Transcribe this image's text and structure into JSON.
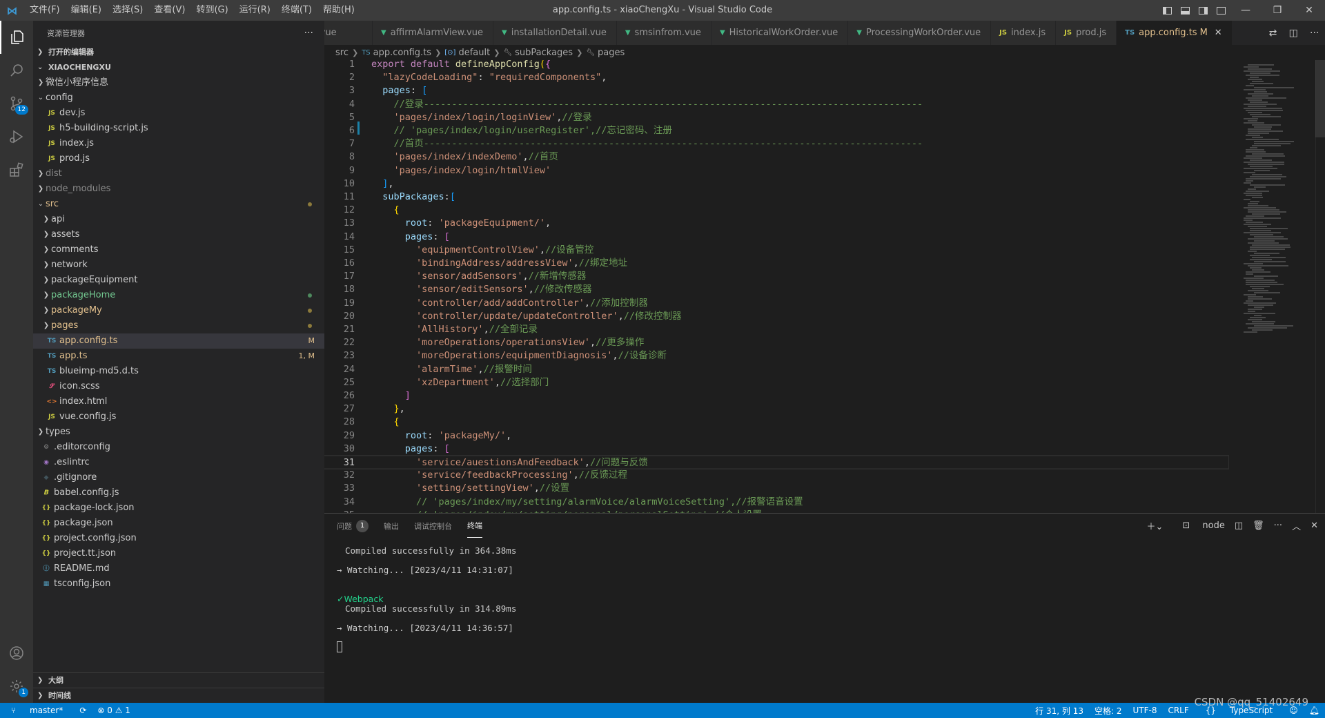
{
  "titlebar": {
    "title": "app.config.ts - xiaoChengXu - Visual Studio Code",
    "menu": [
      "文件(F)",
      "编辑(E)",
      "选择(S)",
      "查看(V)",
      "转到(G)",
      "运行(R)",
      "终端(T)",
      "帮助(H)"
    ],
    "window_controls": [
      "—",
      "❐",
      "✕"
    ]
  },
  "activitybar": {
    "scm_badge": "12",
    "settings_badge": "1"
  },
  "sidebar": {
    "header": "资源管理器",
    "more": "···",
    "open_editors": "打开的编辑器",
    "project": "XIAOCHENGXU",
    "outline": "大纲",
    "timeline": "时间线",
    "tree": [
      {
        "name": "微信小程序信息",
        "indent": 1,
        "type": "folder",
        "open": false
      },
      {
        "name": "config",
        "indent": 1,
        "type": "folder",
        "open": true
      },
      {
        "name": "dev.js",
        "indent": 2,
        "type": "js"
      },
      {
        "name": "h5-building-script.js",
        "indent": 2,
        "type": "js"
      },
      {
        "name": "index.js",
        "indent": 2,
        "type": "js"
      },
      {
        "name": "prod.js",
        "indent": 2,
        "type": "js"
      },
      {
        "name": "dist",
        "indent": 1,
        "type": "folder",
        "open": false,
        "dim": true
      },
      {
        "name": "node_modules",
        "indent": 1,
        "type": "folder",
        "open": false,
        "dim": true
      },
      {
        "name": "src",
        "indent": 1,
        "type": "folder",
        "open": true,
        "color": "yellow",
        "dot": true
      },
      {
        "name": "api",
        "indent": 2,
        "type": "folder",
        "open": false
      },
      {
        "name": "assets",
        "indent": 2,
        "type": "folder",
        "open": false
      },
      {
        "name": "comments",
        "indent": 2,
        "type": "folder",
        "open": false
      },
      {
        "name": "network",
        "indent": 2,
        "type": "folder",
        "open": false
      },
      {
        "name": "packageEquipment",
        "indent": 2,
        "type": "folder",
        "open": false
      },
      {
        "name": "packageHome",
        "indent": 2,
        "type": "folder",
        "open": false,
        "color": "green",
        "dot": true
      },
      {
        "name": "packageMy",
        "indent": 2,
        "type": "folder",
        "open": false,
        "color": "yellow",
        "dot": true
      },
      {
        "name": "pages",
        "indent": 2,
        "type": "folder",
        "open": false,
        "color": "yellow",
        "dot": true
      },
      {
        "name": "app.config.ts",
        "indent": 2,
        "type": "ts",
        "color": "yellow",
        "deco": "M",
        "selected": true
      },
      {
        "name": "app.ts",
        "indent": 2,
        "type": "ts",
        "color": "yellow",
        "deco": "1, M"
      },
      {
        "name": "blueimp-md5.d.ts",
        "indent": 2,
        "type": "ts"
      },
      {
        "name": "icon.scss",
        "indent": 2,
        "type": "scss"
      },
      {
        "name": "index.html",
        "indent": 2,
        "type": "html"
      },
      {
        "name": "vue.config.js",
        "indent": 2,
        "type": "js"
      },
      {
        "name": "types",
        "indent": 1,
        "type": "folder",
        "open": false
      },
      {
        "name": ".editorconfig",
        "indent": 1,
        "type": "gear"
      },
      {
        "name": ".eslintrc",
        "indent": 1,
        "type": "eslint"
      },
      {
        "name": ".gitignore",
        "indent": 1,
        "type": "git"
      },
      {
        "name": "babel.config.js",
        "indent": 1,
        "type": "babel"
      },
      {
        "name": "package-lock.json",
        "indent": 1,
        "type": "json"
      },
      {
        "name": "package.json",
        "indent": 1,
        "type": "json"
      },
      {
        "name": "project.config.json",
        "indent": 1,
        "type": "json"
      },
      {
        "name": "project.tt.json",
        "indent": 1,
        "type": "json"
      },
      {
        "name": "README.md",
        "indent": 1,
        "type": "info"
      },
      {
        "name": "tsconfig.json",
        "indent": 1,
        "type": "tsjson"
      }
    ]
  },
  "tabs": [
    {
      "label": "i.vue",
      "icon": "",
      "type": "vue"
    },
    {
      "label": "affirmAlarmView.vue",
      "icon": "▼",
      "type": "vue"
    },
    {
      "label": "installationDetail.vue",
      "icon": "▼",
      "type": "vue"
    },
    {
      "label": "smsinfrom.vue",
      "icon": "▼",
      "type": "vue"
    },
    {
      "label": "HistoricalWorkOrder.vue",
      "icon": "▼",
      "type": "vue"
    },
    {
      "label": "ProcessingWorkOrder.vue",
      "icon": "▼",
      "type": "vue"
    },
    {
      "label": "index.js",
      "icon": "JS",
      "type": "js"
    },
    {
      "label": "prod.js",
      "icon": "JS",
      "type": "js"
    },
    {
      "label": "app.config.ts",
      "icon": "TS",
      "type": "ts",
      "active": true,
      "modified": "M",
      "close": "✕"
    }
  ],
  "breadcrumb": [
    "src",
    "app.config.ts",
    "default",
    "subPackages",
    "pages"
  ],
  "editor": {
    "current_line": 31,
    "lines": [
      [
        [
          "kw",
          "export default "
        ],
        [
          "fn",
          "defineAppConfig"
        ],
        [
          "b1",
          "("
        ],
        [
          "b2",
          "{"
        ]
      ],
      [
        [
          "p",
          "  "
        ],
        [
          "str",
          "\"lazyCodeLoading\""
        ],
        [
          "p",
          ": "
        ],
        [
          "str",
          "\"requiredComponents\""
        ],
        [
          "p",
          ","
        ]
      ],
      [
        [
          "p",
          "  "
        ],
        [
          "prop",
          "pages"
        ],
        [
          "p",
          ": "
        ],
        [
          "b3",
          "["
        ]
      ],
      [
        [
          "p",
          "    "
        ],
        [
          "cm",
          "//登录-----------------------------------------------------------------------------------------"
        ]
      ],
      [
        [
          "p",
          "    "
        ],
        [
          "str",
          "'pages/index/login/loginView'"
        ],
        [
          "p",
          ","
        ],
        [
          "cm",
          "//登录"
        ]
      ],
      [
        [
          "p",
          "    "
        ],
        [
          "cm",
          "// 'pages/index/login/userRegister',//忘记密码、注册"
        ]
      ],
      [
        [
          "p",
          "    "
        ],
        [
          "cm",
          "//首页-----------------------------------------------------------------------------------------"
        ]
      ],
      [
        [
          "p",
          "    "
        ],
        [
          "str",
          "'pages/index/indexDemo'"
        ],
        [
          "p",
          ","
        ],
        [
          "cm",
          "//首页"
        ]
      ],
      [
        [
          "p",
          "    "
        ],
        [
          "str",
          "'pages/index/login/htmlView'"
        ]
      ],
      [
        [
          "p",
          "  "
        ],
        [
          "b3",
          "]"
        ],
        [
          "p",
          ","
        ]
      ],
      [
        [
          "p",
          "  "
        ],
        [
          "prop",
          "subPackages"
        ],
        [
          "p",
          ":"
        ],
        [
          "b3",
          "["
        ]
      ],
      [
        [
          "p",
          "    "
        ],
        [
          "b1",
          "{"
        ]
      ],
      [
        [
          "p",
          "      "
        ],
        [
          "prop",
          "root"
        ],
        [
          "p",
          ": "
        ],
        [
          "str",
          "'packageEquipment/'"
        ],
        [
          "p",
          ","
        ]
      ],
      [
        [
          "p",
          "      "
        ],
        [
          "prop",
          "pages"
        ],
        [
          "p",
          ": "
        ],
        [
          "b2",
          "["
        ]
      ],
      [
        [
          "p",
          "        "
        ],
        [
          "str",
          "'equipmentControlView'"
        ],
        [
          "p",
          ","
        ],
        [
          "cm",
          "//设备管控"
        ]
      ],
      [
        [
          "p",
          "        "
        ],
        [
          "str",
          "'bindingAddress/addressView'"
        ],
        [
          "p",
          ","
        ],
        [
          "cm",
          "//绑定地址"
        ]
      ],
      [
        [
          "p",
          "        "
        ],
        [
          "str",
          "'sensor/addSensors'"
        ],
        [
          "p",
          ","
        ],
        [
          "cm",
          "//新增传感器"
        ]
      ],
      [
        [
          "p",
          "        "
        ],
        [
          "str",
          "'sensor/editSensors'"
        ],
        [
          "p",
          ","
        ],
        [
          "cm",
          "//修改传感器"
        ]
      ],
      [
        [
          "p",
          "        "
        ],
        [
          "str",
          "'controller/add/addController'"
        ],
        [
          "p",
          ","
        ],
        [
          "cm",
          "//添加控制器"
        ]
      ],
      [
        [
          "p",
          "        "
        ],
        [
          "str",
          "'controller/update/updateController'"
        ],
        [
          "p",
          ","
        ],
        [
          "cm",
          "//修改控制器"
        ]
      ],
      [
        [
          "p",
          "        "
        ],
        [
          "str",
          "'AllHistory'"
        ],
        [
          "p",
          ","
        ],
        [
          "cm",
          "//全部记录"
        ]
      ],
      [
        [
          "p",
          "        "
        ],
        [
          "str",
          "'moreOperations/operationsView'"
        ],
        [
          "p",
          ","
        ],
        [
          "cm",
          "//更多操作"
        ]
      ],
      [
        [
          "p",
          "        "
        ],
        [
          "str",
          "'moreOperations/equipmentDiagnosis'"
        ],
        [
          "p",
          ","
        ],
        [
          "cm",
          "//设备诊断"
        ]
      ],
      [
        [
          "p",
          "        "
        ],
        [
          "str",
          "'alarmTime'"
        ],
        [
          "p",
          ","
        ],
        [
          "cm",
          "//报警时间"
        ]
      ],
      [
        [
          "p",
          "        "
        ],
        [
          "str",
          "'xzDepartment'"
        ],
        [
          "p",
          ","
        ],
        [
          "cm",
          "//选择部门"
        ]
      ],
      [
        [
          "p",
          "      "
        ],
        [
          "b2",
          "]"
        ]
      ],
      [
        [
          "p",
          "    "
        ],
        [
          "b1",
          "}"
        ],
        [
          "p",
          ","
        ]
      ],
      [
        [
          "p",
          "    "
        ],
        [
          "b1",
          "{"
        ]
      ],
      [
        [
          "p",
          "      "
        ],
        [
          "prop",
          "root"
        ],
        [
          "p",
          ": "
        ],
        [
          "str",
          "'packageMy/'"
        ],
        [
          "p",
          ","
        ]
      ],
      [
        [
          "p",
          "      "
        ],
        [
          "prop",
          "pages"
        ],
        [
          "p",
          ": "
        ],
        [
          "b2",
          "["
        ]
      ],
      [
        [
          "p",
          "        "
        ],
        [
          "str",
          "'service/auestionsAndFeedback'"
        ],
        [
          "p",
          ","
        ],
        [
          "cm",
          "//问题与反馈"
        ]
      ],
      [
        [
          "p",
          "        "
        ],
        [
          "str",
          "'service/feedbackProcessing'"
        ],
        [
          "p",
          ","
        ],
        [
          "cm",
          "//反馈过程"
        ]
      ],
      [
        [
          "p",
          "        "
        ],
        [
          "str",
          "'setting/settingView'"
        ],
        [
          "p",
          ","
        ],
        [
          "cm",
          "//设置"
        ]
      ],
      [
        [
          "p",
          "        "
        ],
        [
          "cm",
          "// 'pages/index/my/setting/alarmVoice/alarmVoiceSetting',//报警语音设置"
        ]
      ],
      [
        [
          "p",
          "        "
        ],
        [
          "cm",
          "// 'pages/index/my/setting/personal/personalSetting',//个人设置"
        ]
      ]
    ]
  },
  "panel": {
    "tabs": [
      {
        "label": "问题",
        "badge": "1"
      },
      {
        "label": "输出"
      },
      {
        "label": "调试控制台"
      },
      {
        "label": "终端",
        "active": true
      }
    ],
    "terminal_name": "node",
    "terminal": {
      "compiled_1": "Compiled successfully in 364.38ms",
      "watching_1": "→ Watching... [2023/4/11 14:31:07]",
      "webpack": "Webpack",
      "compiled_2": "Compiled successfully in 314.89ms",
      "watching_2": "→ Watching... [2023/4/11 14:36:57]"
    }
  },
  "statusbar": {
    "branch": "master*",
    "sync": "⟳",
    "problems": "⊗ 0 ⚠ 1",
    "position": "行 31, 列 13",
    "spaces": "空格: 2",
    "encoding": "UTF-8",
    "eol": "CRLF",
    "language": "TypeScript"
  },
  "watermark": "CSDN @qq_51402649"
}
